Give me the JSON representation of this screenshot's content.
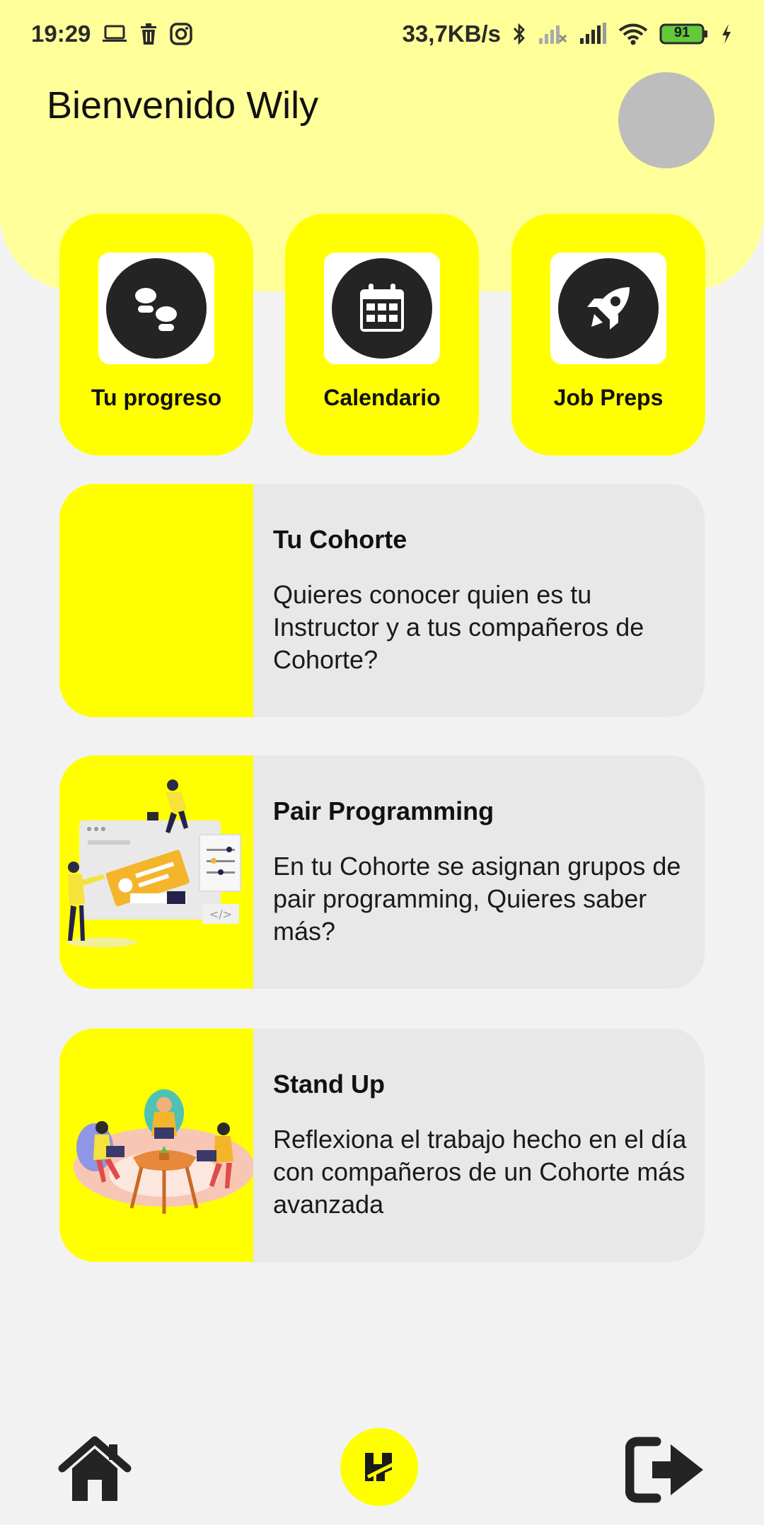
{
  "status_bar": {
    "time": "19:29",
    "left_icons": [
      "laptop-icon",
      "trash-icon",
      "instagram-icon"
    ],
    "speed": "33,7KB/s",
    "battery": "91",
    "right_icons": [
      "bluetooth-icon",
      "signal-off-icon",
      "signal-icon",
      "wifi-icon",
      "battery-icon",
      "charging-icon"
    ]
  },
  "header": {
    "welcome": "Bienvenido Wily",
    "avatar_icon": "avatar"
  },
  "quick_actions": [
    {
      "label": "Tu progreso",
      "icon": "footsteps-icon"
    },
    {
      "label": "Calendario",
      "icon": "calendar-icon"
    },
    {
      "label": "Job Preps",
      "icon": "rocket-icon"
    }
  ],
  "cards": [
    {
      "title": "Tu Cohorte",
      "description": "Quieres conocer quien es tu Instructor y a tus compañeros de Cohorte?",
      "illustration": "none"
    },
    {
      "title": "Pair Programming",
      "description": "En tu Cohorte se asignan grupos de pair programming, Quieres saber más?",
      "illustration": "pair-programming-illustration"
    },
    {
      "title": "Stand Up",
      "description": "Reflexiona el trabajo hecho en el día con compañeros de un Cohorte más avanzada",
      "illustration": "standup-illustration"
    }
  ],
  "bottom_nav": {
    "home_icon": "home-icon",
    "center_icon": "app-logo-icon",
    "logout_icon": "logout-icon"
  },
  "colors": {
    "accent": "#ffff00",
    "header_bg": "#ffff99",
    "card_bg": "#e8e8e8",
    "icon_dark": "#242424"
  }
}
